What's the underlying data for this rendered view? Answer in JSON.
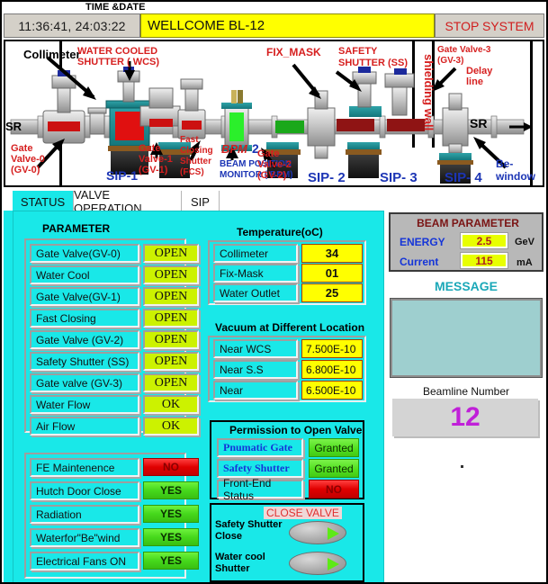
{
  "header": {
    "time_date_label": "TIME &DATE",
    "time": "11:36:41,  24:03:22",
    "welcome": "WELLCOME BL-12",
    "stop_button": "STOP SYSTEM"
  },
  "beamline": {
    "labels": {
      "sr_in": "SR",
      "sr_out": "SR",
      "collimeter": "Collimeter",
      "wcs_line1": "WATER COOLED",
      "wcs_line2": "SHUTTER ( WCS)",
      "fix_mask": "FIX_MASK",
      "safety_shutter_line1": "SAFETY",
      "safety_shutter_line2": "SHUTTER (SS)",
      "gate_valve_3_line1": "Gate Valve-3",
      "gate_valve_3_line2": "(GV-3)",
      "delay_line1": "Delay",
      "delay_line2": "line",
      "shielding_wall": "shielding wall",
      "gv0_line1": "Gate",
      "gv0_line2": "Valve-0",
      "gv0_line3": "(GV-0)",
      "sip1": "SIP-1",
      "gv1_line1": "Gate",
      "gv1_line2": "Valve-1",
      "gv1_line3": "(GV-1)",
      "fcs_line1": "Fast",
      "fcs_line2": "Closing",
      "fcs_line3": "Shutter",
      "fcs_line4": "(FCS)",
      "bpm": "BPM",
      "bpm_num": "2",
      "bpm_line1": "BEAM POSITION",
      "bpm_line2": "MONITOR ( BPM)",
      "sip2": "SIP- 2",
      "gv2_line1": "Gate",
      "gv2_line2": "Valve-2",
      "gv2_line3": "(GV-2)",
      "sip3": "SIP- 3",
      "sip4": "SIP- 4",
      "be_line1": "Be-",
      "be_line2": "window"
    }
  },
  "tabs": [
    {
      "label": "STATUS",
      "active": true
    },
    {
      "label": "VALVE OPERATION",
      "active": false
    },
    {
      "label": "SIP",
      "active": false
    }
  ],
  "parameter": {
    "title": "PARAMETER",
    "rows": [
      {
        "label": "Gate Valve(GV-0)",
        "value": "OPEN"
      },
      {
        "label": "Water Cool",
        "value": "OPEN"
      },
      {
        "label": "Gate Valve(GV-1)",
        "value": "OPEN"
      },
      {
        "label": "Fast Closing",
        "value": "OPEN"
      },
      {
        "label": "Gate Valve (GV-2)",
        "value": "OPEN"
      },
      {
        "label": "Safety Shutter (SS)",
        "value": "OPEN"
      },
      {
        "label": "Gate valve (GV-3)",
        "value": "OPEN"
      },
      {
        "label": "Water  Flow",
        "value": "OK"
      },
      {
        "label": "Air Flow",
        "value": "OK"
      }
    ],
    "rows2": [
      {
        "label": "FE Maintenence",
        "value": "NO",
        "state": "no"
      },
      {
        "label": "Hutch Door Close",
        "value": "YES",
        "state": "yes"
      },
      {
        "label": "Radiation",
        "value": "YES",
        "state": "yes"
      },
      {
        "label": "Waterfor\"Be\"wind",
        "value": "YES",
        "state": "yes"
      },
      {
        "label": "Electrical Fans ON",
        "value": "YES",
        "state": "yes"
      }
    ]
  },
  "temperature": {
    "title": "Temperature(oC)",
    "rows": [
      {
        "label": "Collimeter",
        "value": "34"
      },
      {
        "label": "Fix-Mask",
        "value": "01"
      },
      {
        "label": "Water Outlet",
        "value": "25"
      }
    ]
  },
  "vacuum": {
    "title": "Vacuum at Different Location",
    "rows": [
      {
        "label": "Near WCS",
        "value": "7.500E-10"
      },
      {
        "label": "Near S.S",
        "value": "6.800E-10"
      },
      {
        "label": "Near",
        "value": "6.500E-10"
      }
    ]
  },
  "permission": {
    "title": "Permission to Open Valve",
    "rows": [
      {
        "label": "Pnumatic Gate",
        "value": "Granted",
        "state": "granted"
      },
      {
        "label": "Safety Shutter",
        "value": "Granted",
        "state": "granted"
      },
      {
        "label": "Front-End Status",
        "value": "NO",
        "state": "no"
      }
    ]
  },
  "close_valve": {
    "title": "CLOSE VALVE",
    "rows": [
      {
        "label_line1": "Safety Shutter",
        "label_line2": "Close"
      },
      {
        "label_line1": "Water cool",
        "label_line2": "Shutter"
      }
    ]
  },
  "beam_parameter": {
    "title": "BEAM PARAMETER",
    "energy_label": "ENERGY",
    "energy_value": "2.5",
    "energy_unit": "GeV",
    "current_label": "Current",
    "current_value": "115",
    "current_unit": "mA"
  },
  "message": {
    "title": "MESSAGE",
    "body": ""
  },
  "beamline_number": {
    "title": "Beamline Number",
    "value": "12"
  },
  "colors": {
    "panel_cyan": "#19e8e8",
    "status_open": "#ccf200",
    "status_yes": "#46d81c",
    "status_no": "#e00000",
    "value_yellow": "#ffff00",
    "accent_red": "#d61f1f",
    "accent_blue": "#1c35b5",
    "beam_number": "#c020d8"
  }
}
